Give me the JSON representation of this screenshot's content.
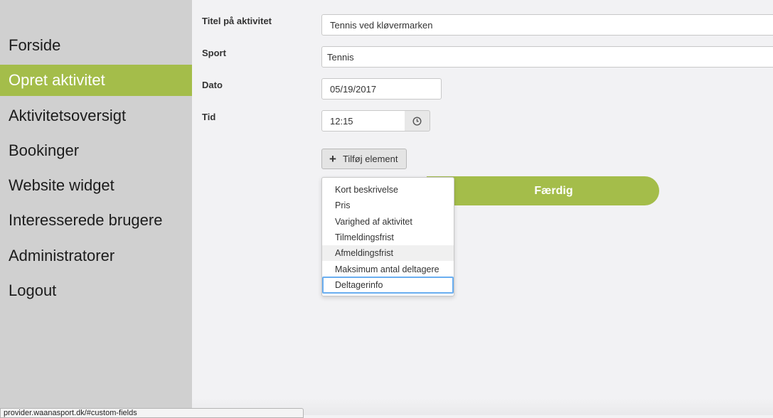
{
  "sidebar": {
    "items": [
      {
        "label": "Forside"
      },
      {
        "label": "Opret aktivitet"
      },
      {
        "label": "Aktivitetsoversigt"
      },
      {
        "label": "Bookinger"
      },
      {
        "label": "Website widget"
      },
      {
        "label": "Interesserede brugere"
      },
      {
        "label": "Administratorer"
      },
      {
        "label": "Logout"
      }
    ],
    "active_color": "#a4bd4a"
  },
  "form": {
    "title_label": "Titel på aktivitet",
    "title_value": "Tennis ved kløvermarken",
    "sport_label": "Sport",
    "sport_value": "Tennis",
    "date_label": "Dato",
    "date_value": "05/19/2017",
    "time_label": "Tid",
    "time_value": "12:15",
    "time_icon": "clock-icon"
  },
  "add_element": {
    "label": "Tilføj element",
    "icon": "plus-icon"
  },
  "done_button": {
    "label": "Færdig"
  },
  "dropdown": {
    "options": [
      "Kort beskrivelse",
      "Pris",
      "Varighed af aktivitet",
      "Tilmeldingsfrist",
      "Afmeldingsfrist",
      "Maksimum antal deltagere",
      "Deltagerinfo"
    ],
    "hovered": "Afmeldingsfrist",
    "focused": "Deltagerinfo"
  },
  "status_bar": {
    "url": "provider.waanasport.dk/#custom-fields"
  }
}
